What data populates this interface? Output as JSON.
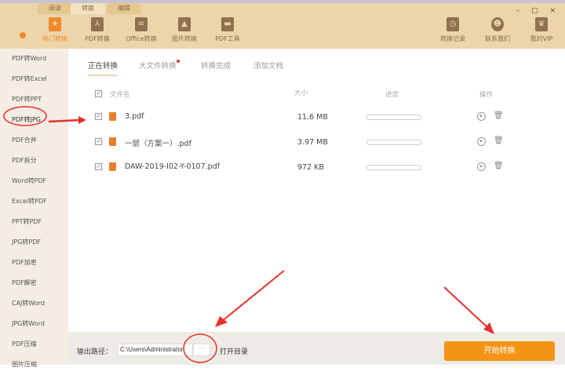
{
  "header": {
    "tabs": [
      "阅读",
      "转换",
      "编辑"
    ],
    "active_tab": 1,
    "tools": [
      {
        "label": "热门转换",
        "icon": "star-doc-icon"
      },
      {
        "label": "PDF转换",
        "icon": "pdf-icon"
      },
      {
        "label": "Office转换",
        "icon": "document-icon"
      },
      {
        "label": "图片转换",
        "icon": "image-icon"
      },
      {
        "label": "PDF工具",
        "icon": "toolbox-icon"
      }
    ],
    "right_tools": [
      {
        "label": "转换记录",
        "icon": "history-icon"
      },
      {
        "label": "联系我们",
        "icon": "support-icon"
      },
      {
        "label": "我的VIP",
        "icon": "crown-icon"
      }
    ],
    "window_controls": "– □ ×"
  },
  "sidebar": {
    "items": [
      "PDF转Word",
      "PDF转Excel",
      "PDF转PPT",
      "PDF转JPG",
      "PDF合并",
      "PDF拆分",
      "Word转PDF",
      "Excel转PDF",
      "PPT转PDF",
      "JPG转PDF",
      "PDF加密",
      "PDF解密",
      "CAJ转Word",
      "JPG转Word",
      "PDF压缩",
      "图片压缩"
    ],
    "selected": "PDF转JPG"
  },
  "main": {
    "tabs": [
      "正在转换",
      "大文件转换",
      "转换完成",
      "添加文档"
    ],
    "columns": {
      "name": "文件名",
      "size": "大小",
      "progress": "进度",
      "actions": "操作"
    },
    "files": [
      {
        "name": "3.pdf",
        "size": "11.6 MB",
        "progress": 0
      },
      {
        "name": "一层（方案一）.pdf",
        "size": "3.97 MB",
        "progress": 0
      },
      {
        "name": "DAW-2019-I02-Y-0107.pdf",
        "size": "972 KB",
        "progress": 0
      }
    ]
  },
  "bottom": {
    "output_label": "输出路径：",
    "output_path": "C:\\Users\\Administrator",
    "more": "···",
    "open_dir": "打开目录",
    "start": "开始转换"
  },
  "colors": {
    "accent": "#f39417",
    "header_bg": "#ecd5ab",
    "annotation": "#e8302a"
  }
}
